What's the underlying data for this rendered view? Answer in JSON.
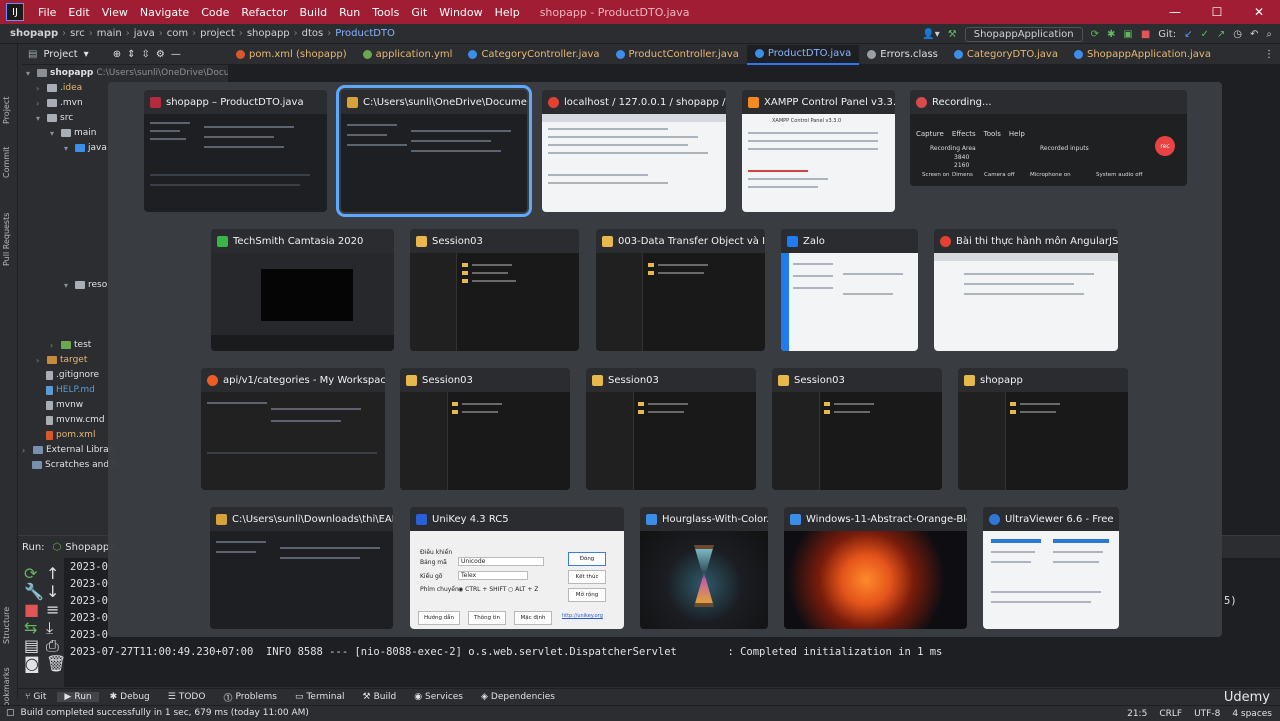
{
  "ide": {
    "menu": [
      "File",
      "Edit",
      "View",
      "Navigate",
      "Code",
      "Refactor",
      "Build",
      "Run",
      "Tools",
      "Git",
      "Window",
      "Help"
    ],
    "window_title": "shopapp - ProductDTO.java",
    "breadcrumb": [
      "shopapp",
      "src",
      "main",
      "java",
      "com",
      "project",
      "shopapp",
      "dtos",
      "ProductDTO"
    ],
    "run_config": "ShopappApplication",
    "git_label": "Git:",
    "project_label": "Project",
    "tabs": [
      "pom.xml (shopapp)",
      "application.yml",
      "CategoryController.java",
      "ProductController.java",
      "ProductDTO.java",
      "Errors.class",
      "CategoryDTO.java",
      "ShopappApplication.java"
    ],
    "side_labels": [
      "Project",
      "Commit",
      "Pull Requests",
      "Structure",
      "Bookmarks"
    ],
    "tree": {
      "root": "shopapp",
      "root_path": "C:\\Users\\sunli\\OneDrive\\Documer",
      "items": [
        ".idea",
        ".mvn",
        "src",
        "main",
        "java",
        "reso",
        "test",
        "target",
        ".gitignore",
        "HELP.md",
        "mvnw",
        "mvnw.cmd",
        "pom.xml",
        "External Librari",
        "Scratches and C"
      ]
    },
    "run": {
      "label": "Run:",
      "tab": "ShopappA",
      "log_prefix": [
        "2023-0",
        "2023-0",
        "2023-0",
        "2023-0",
        "2023-0"
      ],
      "last_line": "2023-07-27T11:00:49.230+07:00  INFO 8588 --- [nio-8088-exec-2] o.s.web.servlet.DispatcherServlet        : Completed initialization in 1 ms",
      "right_fragment": "5)"
    },
    "bottom_tools": [
      "Git",
      "Run",
      "Debug",
      "TODO",
      "Problems",
      "Terminal",
      "Build",
      "Services",
      "Dependencies"
    ],
    "status": {
      "message": "Build completed successfully in 1 sec, 679 ms (today 11:00 AM)",
      "position": "21:5",
      "line_ending": "CRLF",
      "encoding": "UTF-8",
      "indent": "4 spaces"
    },
    "watermark": "Udemy"
  },
  "switcher": {
    "windows": [
      {
        "title": "shopapp – ProductDTO.java",
        "icon_color": "#b42a3f",
        "kind": "ide"
      },
      {
        "title": "C:\\Users\\sunli\\OneDrive\\Document...",
        "icon_color": "#d8a23a",
        "kind": "ide",
        "selected": true
      },
      {
        "title": "localhost / 127.0.0.1 / shopapp / pr...",
        "icon_color": "#e34133",
        "kind": "light"
      },
      {
        "title": "XAMPP Control Panel v3.3.0...",
        "icon_color": "#f28a1e",
        "kind": "xampp"
      },
      {
        "title": "Recording...",
        "icon_color": "#d94a4a",
        "kind": "recording"
      },
      {
        "title": "TechSmith Camtasia 2020",
        "icon_color": "#3ab54a",
        "kind": "camtasia"
      },
      {
        "title": "Session03",
        "icon_color": "#e7b84b",
        "kind": "explorer"
      },
      {
        "title": "003-Data Transfer Object và Inp...",
        "icon_color": "#e7b84b",
        "kind": "explorer"
      },
      {
        "title": "Zalo",
        "icon_color": "#1f7bf2",
        "kind": "light"
      },
      {
        "title": "Bài thi thực hành môn AngularJS &...",
        "icon_color": "#e34133",
        "kind": "light"
      },
      {
        "title": "api/v1/categories - My Workspace",
        "icon_color": "#ef5b25",
        "kind": "ide"
      },
      {
        "title": "Session03",
        "icon_color": "#e7b84b",
        "kind": "explorer"
      },
      {
        "title": "Session03",
        "icon_color": "#e7b84b",
        "kind": "explorer"
      },
      {
        "title": "Session03",
        "icon_color": "#e7b84b",
        "kind": "explorer"
      },
      {
        "title": "shopapp",
        "icon_color": "#e7b84b",
        "kind": "explorer"
      },
      {
        "title": "C:\\Users\\sunli\\Downloads\\thi\\EAD_...",
        "icon_color": "#d8a23a",
        "kind": "ide"
      },
      {
        "title": "UniKey 4.3 RC5",
        "icon_color": "#2b5fd9",
        "kind": "unikey"
      },
      {
        "title": "Hourglass-With-Color...",
        "icon_color": "#3a8ee6",
        "kind": "hourglass"
      },
      {
        "title": "Windows-11-Abstract-Orange-Bloo...",
        "icon_color": "#3a8ee6",
        "kind": "orange"
      },
      {
        "title": "UltraViewer 6.6 - Free",
        "icon_color": "#2d77d6",
        "kind": "light"
      }
    ],
    "recording": {
      "menu": [
        "Capture",
        "Effects",
        "Tools",
        "Help"
      ],
      "recording_area": "Recording Area",
      "recorded_inputs": "Recorded inputs",
      "items": [
        "Screen on",
        "Dimens",
        "Camera off",
        "Microphone on",
        "System audio off"
      ],
      "dims": [
        "3840",
        "2160"
      ],
      "rec": "rec"
    },
    "unikey": {
      "fields": [
        "Điều khiển",
        "Bảng mã",
        "Kiểu gõ",
        "Phím chuyển"
      ],
      "values": [
        "Unicode",
        "Telex"
      ],
      "switch_options": [
        "CTRL + SHIFT",
        "ALT + Z"
      ],
      "buttons": [
        "Đóng",
        "Kết thúc",
        "Mở rộng",
        "Hướng dẫn",
        "Thông tin",
        "Mặc định"
      ],
      "link": "http://unikey.org"
    },
    "xampp_header": "XAMPP Control Panel v3.3.0"
  }
}
